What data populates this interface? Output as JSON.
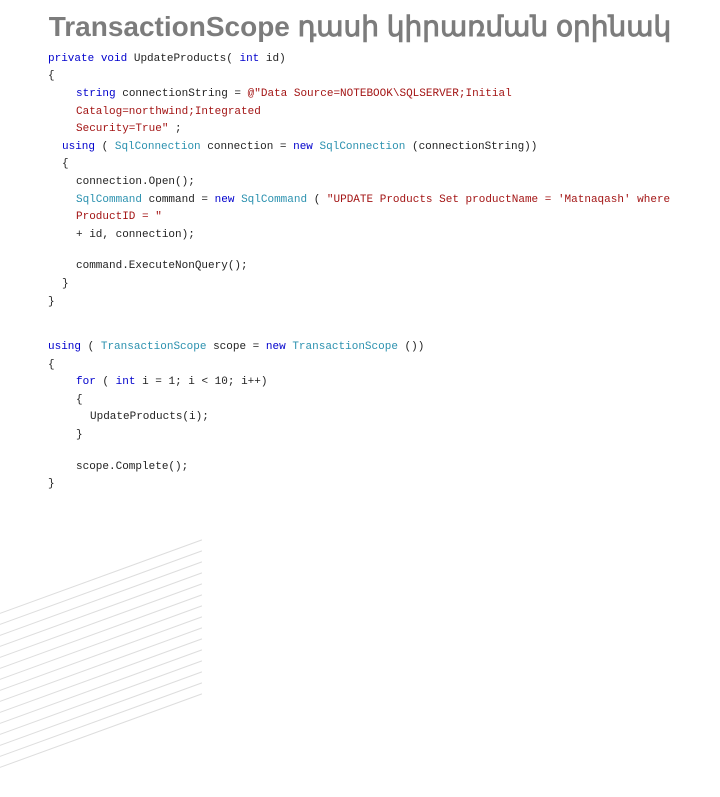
{
  "title": "TransactionScope դասի կիրառման օրինակ",
  "c": {
    "l1_kw1": "private",
    "l1_kw2": "void",
    "l1_name": " UpdateProducts(",
    "l1_kw3": "int",
    "l1_rest": " id)",
    "l2": "{",
    "l3_kw": "string",
    "l3_txt": " connectionString = ",
    "l3_str": "@\"Data Source=NOTEBOOK\\SQLSERVER;Initial Catalog=northwind;Integrated",
    "l3b_str": "Security=True\"",
    "l3b_txt": ";",
    "l4_kw1": "using",
    "l4_txt1": " (",
    "l4_type1": "SqlConnection",
    "l4_txt2": " connection = ",
    "l4_kw2": "new",
    "l4_sp": " ",
    "l4_type2": "SqlConnection",
    "l4_txt3": "(connectionString))",
    "l5": "{",
    "l6": "connection.Open();",
    "l7_type1": "SqlCommand",
    "l7_txt1": " command = ",
    "l7_kw": "new",
    "l7_sp": " ",
    "l7_type2": "SqlCommand",
    "l7_txt2": "(",
    "l7_str": "\"UPDATE Products Set productName = 'Matnaqash' where ProductID = \"",
    "l7b": "+ id, connection);",
    "l8": "command.ExecuteNonQuery();",
    "l9": "}",
    "l10": "}",
    "l11_kw1": "using",
    "l11_txt1": " (",
    "l11_type1": "TransactionScope",
    "l11_txt2": " scope = ",
    "l11_kw2": "new",
    "l11_sp": " ",
    "l11_type2": "TransactionScope",
    "l11_txt3": "())",
    "l12": "{",
    "l13_kw1": "for",
    "l13_txt1": " (",
    "l13_kw2": "int",
    "l13_txt2": " i = 1; i < 10; i++)",
    "l14": "{",
    "l15": "UpdateProducts(i);",
    "l16": "}",
    "l17": "scope.Complete();",
    "l18": "}"
  }
}
